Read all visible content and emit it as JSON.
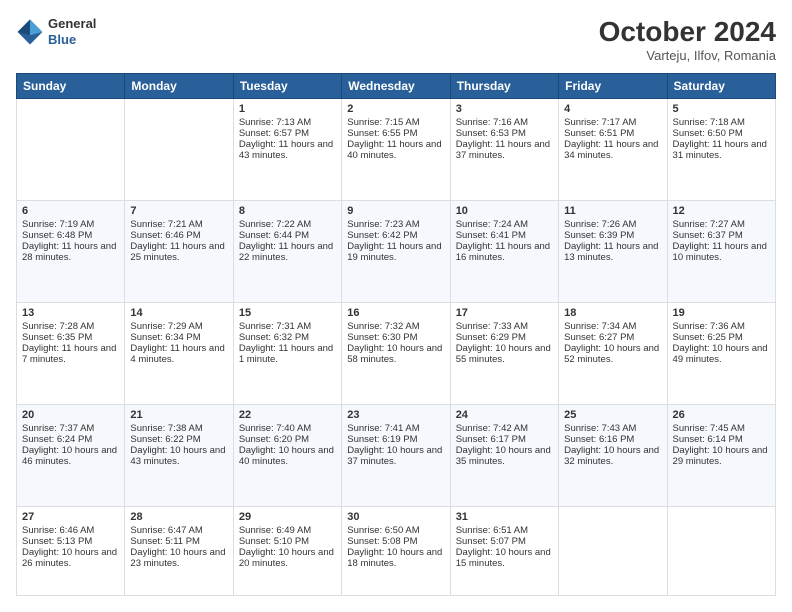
{
  "logo": {
    "line1": "General",
    "line2": "Blue"
  },
  "title": "October 2024",
  "subtitle": "Varteju, Ilfov, Romania",
  "headers": [
    "Sunday",
    "Monday",
    "Tuesday",
    "Wednesday",
    "Thursday",
    "Friday",
    "Saturday"
  ],
  "weeks": [
    [
      {
        "day": "",
        "sunrise": "",
        "sunset": "",
        "daylight": ""
      },
      {
        "day": "",
        "sunrise": "",
        "sunset": "",
        "daylight": ""
      },
      {
        "day": "1",
        "sunrise": "Sunrise: 7:13 AM",
        "sunset": "Sunset: 6:57 PM",
        "daylight": "Daylight: 11 hours and 43 minutes."
      },
      {
        "day": "2",
        "sunrise": "Sunrise: 7:15 AM",
        "sunset": "Sunset: 6:55 PM",
        "daylight": "Daylight: 11 hours and 40 minutes."
      },
      {
        "day": "3",
        "sunrise": "Sunrise: 7:16 AM",
        "sunset": "Sunset: 6:53 PM",
        "daylight": "Daylight: 11 hours and 37 minutes."
      },
      {
        "day": "4",
        "sunrise": "Sunrise: 7:17 AM",
        "sunset": "Sunset: 6:51 PM",
        "daylight": "Daylight: 11 hours and 34 minutes."
      },
      {
        "day": "5",
        "sunrise": "Sunrise: 7:18 AM",
        "sunset": "Sunset: 6:50 PM",
        "daylight": "Daylight: 11 hours and 31 minutes."
      }
    ],
    [
      {
        "day": "6",
        "sunrise": "Sunrise: 7:19 AM",
        "sunset": "Sunset: 6:48 PM",
        "daylight": "Daylight: 11 hours and 28 minutes."
      },
      {
        "day": "7",
        "sunrise": "Sunrise: 7:21 AM",
        "sunset": "Sunset: 6:46 PM",
        "daylight": "Daylight: 11 hours and 25 minutes."
      },
      {
        "day": "8",
        "sunrise": "Sunrise: 7:22 AM",
        "sunset": "Sunset: 6:44 PM",
        "daylight": "Daylight: 11 hours and 22 minutes."
      },
      {
        "day": "9",
        "sunrise": "Sunrise: 7:23 AM",
        "sunset": "Sunset: 6:42 PM",
        "daylight": "Daylight: 11 hours and 19 minutes."
      },
      {
        "day": "10",
        "sunrise": "Sunrise: 7:24 AM",
        "sunset": "Sunset: 6:41 PM",
        "daylight": "Daylight: 11 hours and 16 minutes."
      },
      {
        "day": "11",
        "sunrise": "Sunrise: 7:26 AM",
        "sunset": "Sunset: 6:39 PM",
        "daylight": "Daylight: 11 hours and 13 minutes."
      },
      {
        "day": "12",
        "sunrise": "Sunrise: 7:27 AM",
        "sunset": "Sunset: 6:37 PM",
        "daylight": "Daylight: 11 hours and 10 minutes."
      }
    ],
    [
      {
        "day": "13",
        "sunrise": "Sunrise: 7:28 AM",
        "sunset": "Sunset: 6:35 PM",
        "daylight": "Daylight: 11 hours and 7 minutes."
      },
      {
        "day": "14",
        "sunrise": "Sunrise: 7:29 AM",
        "sunset": "Sunset: 6:34 PM",
        "daylight": "Daylight: 11 hours and 4 minutes."
      },
      {
        "day": "15",
        "sunrise": "Sunrise: 7:31 AM",
        "sunset": "Sunset: 6:32 PM",
        "daylight": "Daylight: 11 hours and 1 minute."
      },
      {
        "day": "16",
        "sunrise": "Sunrise: 7:32 AM",
        "sunset": "Sunset: 6:30 PM",
        "daylight": "Daylight: 10 hours and 58 minutes."
      },
      {
        "day": "17",
        "sunrise": "Sunrise: 7:33 AM",
        "sunset": "Sunset: 6:29 PM",
        "daylight": "Daylight: 10 hours and 55 minutes."
      },
      {
        "day": "18",
        "sunrise": "Sunrise: 7:34 AM",
        "sunset": "Sunset: 6:27 PM",
        "daylight": "Daylight: 10 hours and 52 minutes."
      },
      {
        "day": "19",
        "sunrise": "Sunrise: 7:36 AM",
        "sunset": "Sunset: 6:25 PM",
        "daylight": "Daylight: 10 hours and 49 minutes."
      }
    ],
    [
      {
        "day": "20",
        "sunrise": "Sunrise: 7:37 AM",
        "sunset": "Sunset: 6:24 PM",
        "daylight": "Daylight: 10 hours and 46 minutes."
      },
      {
        "day": "21",
        "sunrise": "Sunrise: 7:38 AM",
        "sunset": "Sunset: 6:22 PM",
        "daylight": "Daylight: 10 hours and 43 minutes."
      },
      {
        "day": "22",
        "sunrise": "Sunrise: 7:40 AM",
        "sunset": "Sunset: 6:20 PM",
        "daylight": "Daylight: 10 hours and 40 minutes."
      },
      {
        "day": "23",
        "sunrise": "Sunrise: 7:41 AM",
        "sunset": "Sunset: 6:19 PM",
        "daylight": "Daylight: 10 hours and 37 minutes."
      },
      {
        "day": "24",
        "sunrise": "Sunrise: 7:42 AM",
        "sunset": "Sunset: 6:17 PM",
        "daylight": "Daylight: 10 hours and 35 minutes."
      },
      {
        "day": "25",
        "sunrise": "Sunrise: 7:43 AM",
        "sunset": "Sunset: 6:16 PM",
        "daylight": "Daylight: 10 hours and 32 minutes."
      },
      {
        "day": "26",
        "sunrise": "Sunrise: 7:45 AM",
        "sunset": "Sunset: 6:14 PM",
        "daylight": "Daylight: 10 hours and 29 minutes."
      }
    ],
    [
      {
        "day": "27",
        "sunrise": "Sunrise: 6:46 AM",
        "sunset": "Sunset: 5:13 PM",
        "daylight": "Daylight: 10 hours and 26 minutes."
      },
      {
        "day": "28",
        "sunrise": "Sunrise: 6:47 AM",
        "sunset": "Sunset: 5:11 PM",
        "daylight": "Daylight: 10 hours and 23 minutes."
      },
      {
        "day": "29",
        "sunrise": "Sunrise: 6:49 AM",
        "sunset": "Sunset: 5:10 PM",
        "daylight": "Daylight: 10 hours and 20 minutes."
      },
      {
        "day": "30",
        "sunrise": "Sunrise: 6:50 AM",
        "sunset": "Sunset: 5:08 PM",
        "daylight": "Daylight: 10 hours and 18 minutes."
      },
      {
        "day": "31",
        "sunrise": "Sunrise: 6:51 AM",
        "sunset": "Sunset: 5:07 PM",
        "daylight": "Daylight: 10 hours and 15 minutes."
      },
      {
        "day": "",
        "sunrise": "",
        "sunset": "",
        "daylight": ""
      },
      {
        "day": "",
        "sunrise": "",
        "sunset": "",
        "daylight": ""
      }
    ]
  ]
}
